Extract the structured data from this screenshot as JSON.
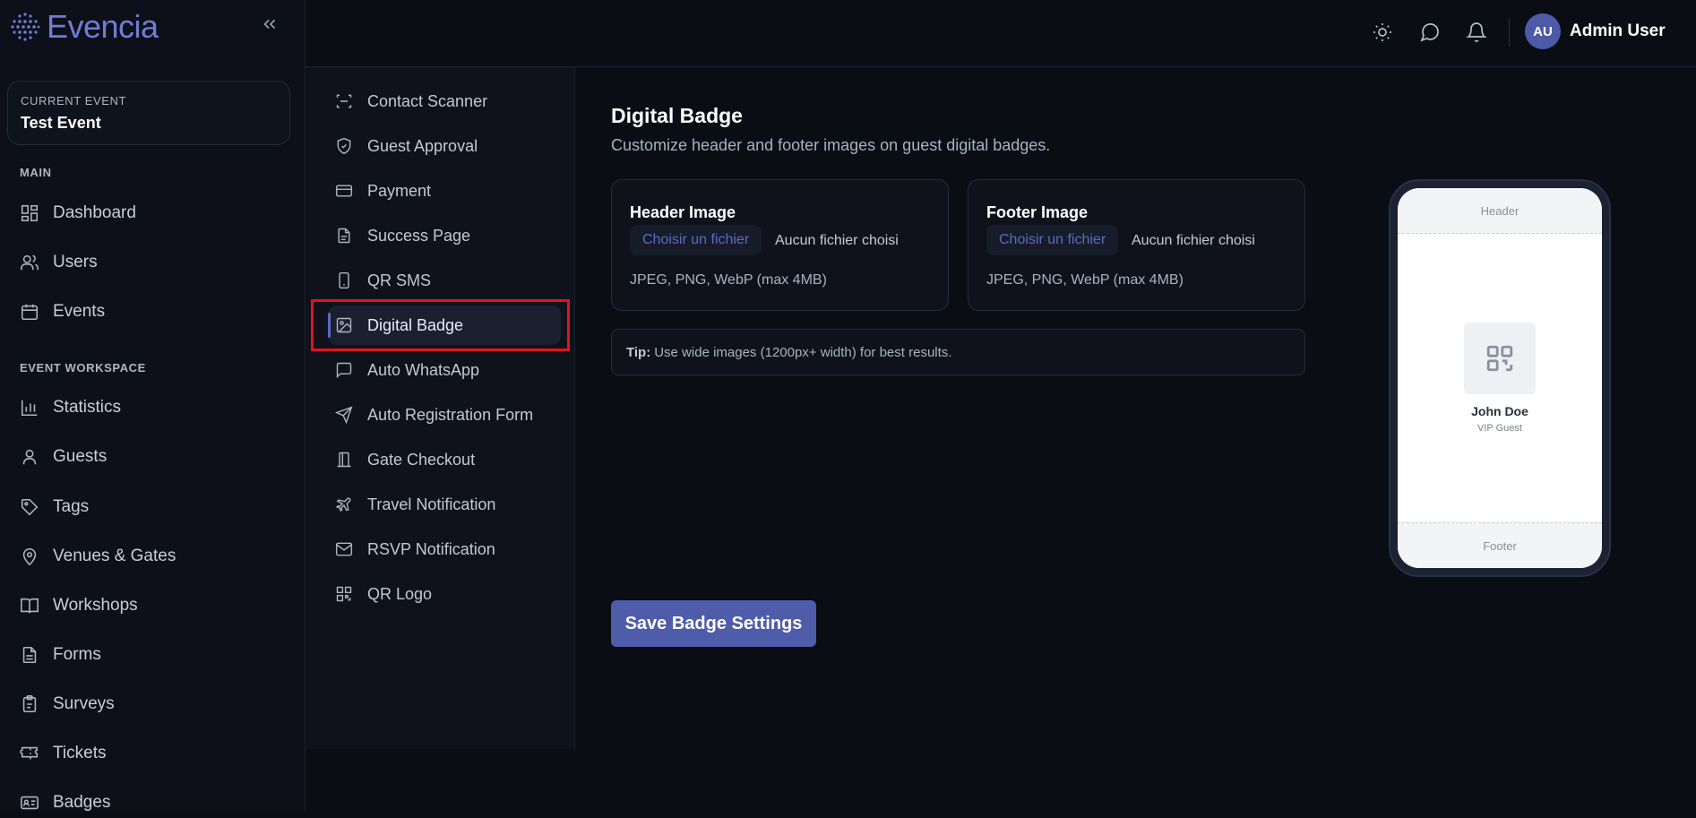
{
  "brand": {
    "name": "Evencia",
    "accent": "#6f7cd8"
  },
  "sidebar": {
    "current_event_label": "CURRENT EVENT",
    "current_event_name": "Test Event",
    "main_label": "MAIN",
    "main_items": [
      {
        "label": "Dashboard",
        "icon": "dashboard-icon"
      },
      {
        "label": "Users",
        "icon": "users-icon"
      },
      {
        "label": "Events",
        "icon": "calendar-icon"
      }
    ],
    "workspace_label": "EVENT WORKSPACE",
    "workspace_items": [
      {
        "label": "Statistics",
        "icon": "bar-chart-icon"
      },
      {
        "label": "Guests",
        "icon": "user-icon"
      },
      {
        "label": "Tags",
        "icon": "tag-icon"
      },
      {
        "label": "Venues & Gates",
        "icon": "map-pin-icon"
      },
      {
        "label": "Workshops",
        "icon": "book-icon"
      },
      {
        "label": "Forms",
        "icon": "file-text-icon"
      },
      {
        "label": "Surveys",
        "icon": "clipboard-icon"
      },
      {
        "label": "Tickets",
        "icon": "ticket-icon"
      },
      {
        "label": "Badges",
        "icon": "id-card-icon"
      }
    ]
  },
  "topbar": {
    "avatar_initials": "AU",
    "user_name": "Admin User"
  },
  "subnav": {
    "items": [
      {
        "label": "Contact Scanner",
        "icon": "scan-icon"
      },
      {
        "label": "Guest Approval",
        "icon": "shield-check-icon"
      },
      {
        "label": "Payment",
        "icon": "credit-card-icon"
      },
      {
        "label": "Success Page",
        "icon": "file-icon"
      },
      {
        "label": "QR SMS",
        "icon": "smartphone-icon"
      },
      {
        "label": "Digital Badge",
        "icon": "image-icon",
        "active": true
      },
      {
        "label": "Auto WhatsApp",
        "icon": "message-icon"
      },
      {
        "label": "Auto Registration Form",
        "icon": "send-icon"
      },
      {
        "label": "Gate Checkout",
        "icon": "door-icon"
      },
      {
        "label": "Travel Notification",
        "icon": "plane-icon"
      },
      {
        "label": "RSVP Notification",
        "icon": "mail-icon"
      },
      {
        "label": "QR Logo",
        "icon": "qr-code-icon"
      }
    ]
  },
  "main": {
    "title": "Digital Badge",
    "subtitle": "Customize header and footer images on guest digital badges.",
    "header_card": {
      "title": "Header Image",
      "button": "Choisir un fichier",
      "status": "Aucun fichier choisi",
      "hint": "JPEG, PNG, WebP (max 4MB)"
    },
    "footer_card": {
      "title": "Footer Image",
      "button": "Choisir un fichier",
      "status": "Aucun fichier choisi",
      "hint": "JPEG, PNG, WebP (max 4MB)"
    },
    "tip_label": "Tip:",
    "tip_text": "Use wide images (1200px+ width) for best results.",
    "save_button": "Save Badge Settings"
  },
  "preview": {
    "header": "Header",
    "footer": "Footer",
    "name": "John Doe",
    "role": "VIP Guest"
  }
}
